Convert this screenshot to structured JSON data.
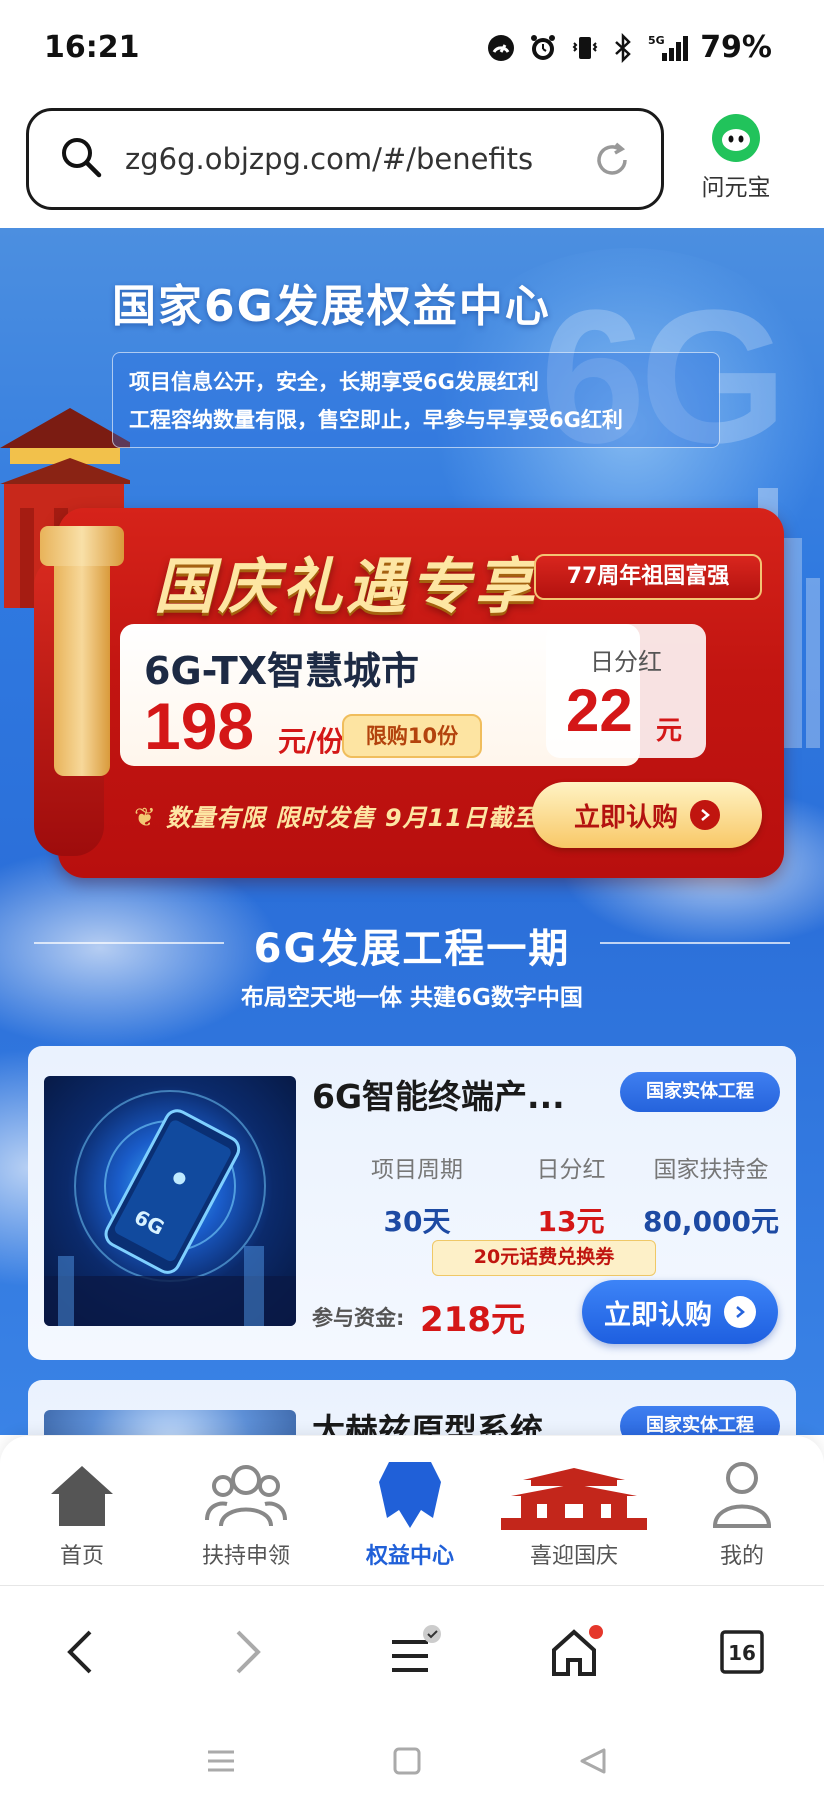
{
  "status_bar": {
    "time": "16:21",
    "battery": "79%"
  },
  "browser": {
    "url": "zg6g.objzpg.com/#/benefits",
    "assistant_label": "问元宝"
  },
  "hero": {
    "title": "国家6G发展权益中心",
    "notice_lines": [
      "项目信息公开，安全，长期享受6G发展红利",
      "工程容纳数量有限，售空即止，早参与早享受6G红利"
    ]
  },
  "promo": {
    "title": "国庆礼遇专享",
    "badge": "77周年祖国富强",
    "product_name": "6G-TX智慧城市",
    "price": "198",
    "price_unit": "元/份",
    "limit": "限购10份",
    "dividend_label": "日分红",
    "dividend_value": "22",
    "dividend_unit": "元",
    "footer": "数量有限  限时发售  9月11日截至",
    "buy_label": "立即认购"
  },
  "section": {
    "title": "6G发展工程一期",
    "subtitle": "布局空天地一体 共建6G数字中国"
  },
  "projects": [
    {
      "name": "6G智能终端产...",
      "tag": "国家实体工程",
      "stats": [
        {
          "label": "项目周期",
          "value": "30天"
        },
        {
          "label": "日分红",
          "value": "13元"
        },
        {
          "label": "国家扶持金",
          "value": "80,000元"
        }
      ],
      "voucher": "20元话费兑换券",
      "invest_label": "参与资金:",
      "invest_value": "218元",
      "buy_label": "立即认购"
    },
    {
      "name": "大赫兹原型系统",
      "tag": "国家实体工程"
    }
  ],
  "tabs": [
    {
      "label": "首页",
      "icon": "home-icon"
    },
    {
      "label": "扶持申领",
      "icon": "people-icon"
    },
    {
      "label": "权益中心",
      "icon": "badge-icon",
      "active": true
    },
    {
      "label": "喜迎国庆",
      "icon": "gate-icon"
    },
    {
      "label": "我的",
      "icon": "user-icon"
    }
  ],
  "browser_nav": {
    "tab_count": "16"
  },
  "colors": {
    "primary_blue": "#2060d8",
    "accent_red": "#d41717",
    "gold": "#fde6a3"
  }
}
